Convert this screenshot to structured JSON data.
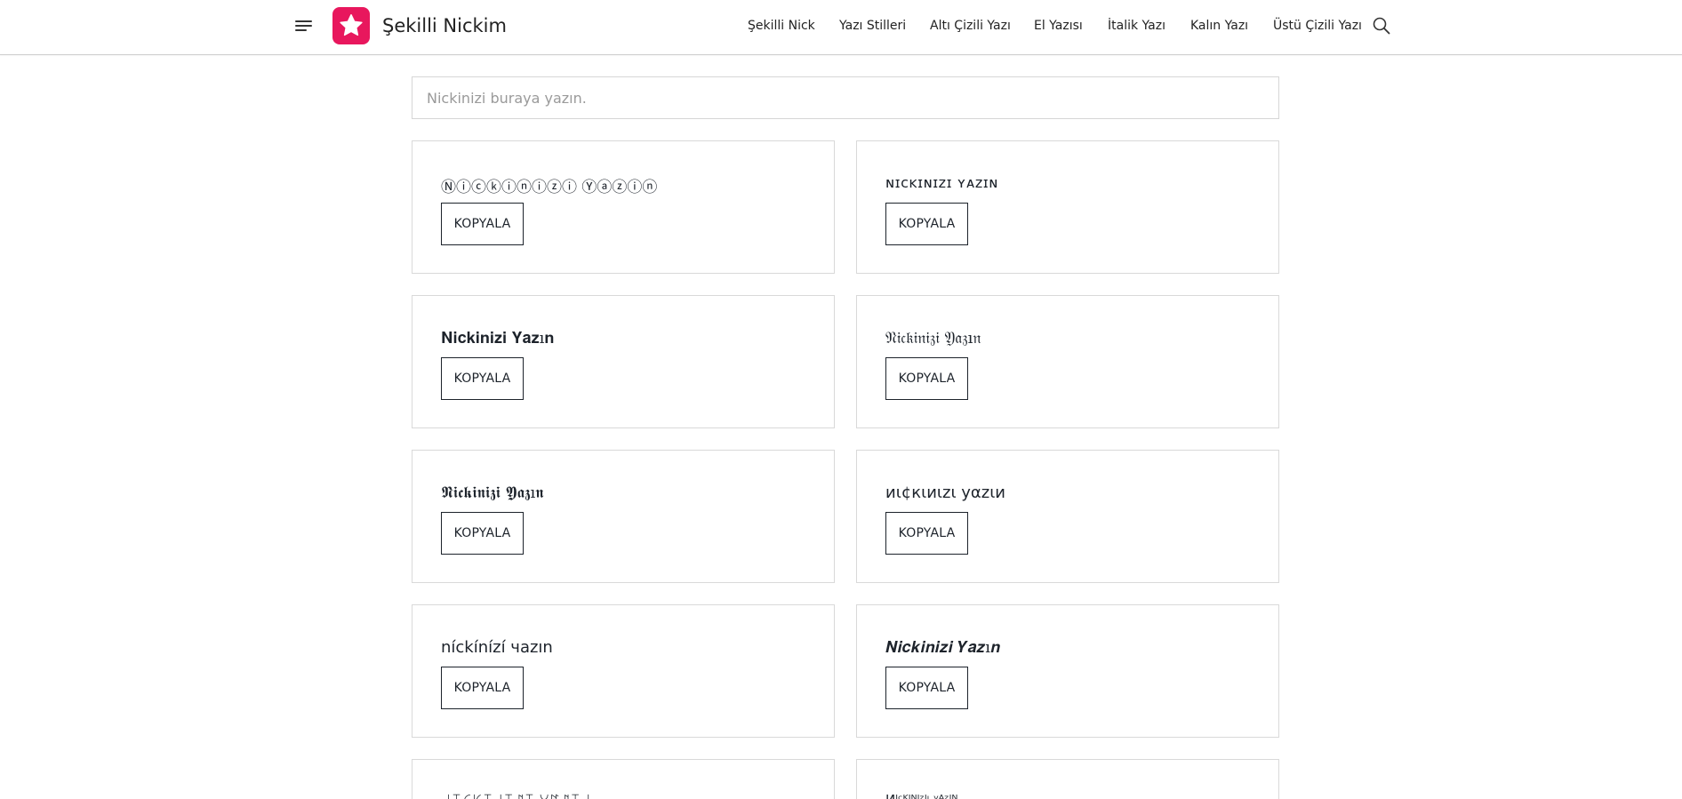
{
  "header": {
    "brand": "Şekilli Nickim",
    "brand_color": "#e8175d",
    "nav": [
      "Şekilli Nick",
      "Yazı Stilleri",
      "Altı Çizili Yazı",
      "El Yazısı",
      "İtalik Yazı",
      "Kalın Yazı",
      "Üstü Çizili Yazı"
    ],
    "menu_icon": "hamburger-menu-icon",
    "search_icon": "search-icon",
    "logo_icon": "star-icon"
  },
  "input": {
    "placeholder": "Nickinizi buraya yazın.",
    "value": ""
  },
  "cards": [
    {
      "text": "Ⓝⓘⓒⓚⓘⓝⓘⓩⓘ Ⓨⓐⓩⓘⓝ",
      "button": "KOPYALA"
    },
    {
      "text": "ɴɪᴄᴋɪɴɪᴢɪ ʏᴀᴢɪɴ",
      "button": "KOPYALA"
    },
    {
      "text": "𝐍𝐢𝐜𝐤𝐢𝐧𝐢𝐳𝐢 𝐘𝐚𝐳ı𝐧",
      "button": "KOPYALA"
    },
    {
      "text": "𝔑𝔦𝔠𝔨𝔦𝔫𝔦𝔷𝔦 𝔜𝔞𝔷ı𝔫",
      "button": "KOPYALA"
    },
    {
      "text": "𝕹𝖎𝖈𝖐𝖎𝖓𝖎𝖟𝖎 𝖄𝖆𝖟ı𝖓",
      "button": "KOPYALA"
    },
    {
      "text": "иι¢кιиιzι уαzιи",
      "button": "KOPYALA"
    },
    {
      "text": "níckínízí чazın",
      "button": "KOPYALA"
    },
    {
      "text": "𝑵𝒊𝒄𝒌𝒊𝒏𝒊𝒛𝒊 𝒀𝒂𝒛ı𝒏",
      "button": "KOPYALA"
    },
    {
      "text": "ꈤꀤꉔꀘꀤꈤꀤꁴꀤ ꌩꍏꁴꀤꈤ",
      "button": ""
    },
    {
      "text": "Иᴵᶜᴷᴵᴺᴵᶻᴵᵎ ʸᴬᶻᴵᴺ",
      "button": ""
    }
  ]
}
